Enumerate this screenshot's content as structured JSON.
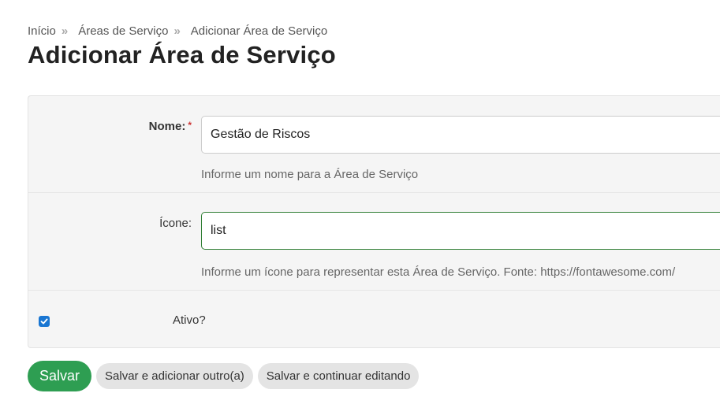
{
  "breadcrumb": {
    "items": [
      "Início",
      "Áreas de Serviço",
      "Adicionar Área de Serviço"
    ],
    "separator": "»"
  },
  "page_title": "Adicionar Área de Serviço",
  "form": {
    "name": {
      "label": "Nome:",
      "required_mark": "*",
      "value": "Gestão de Riscos",
      "help": "Informe um nome para a Área de Serviço"
    },
    "icon": {
      "label": "Ícone:",
      "value": "list",
      "help": "Informe um ícone para representar esta Área de Serviço. Fonte: https://fontawesome.com/"
    },
    "active": {
      "label": "Ativo?",
      "checked": true,
      "check_icon": "check-icon"
    }
  },
  "actions": {
    "save_label": "Salvar",
    "save_add_label": "Salvar e adicionar outro(a)",
    "save_continue_label": "Salvar e continuar editando"
  },
  "colors": {
    "save_button": "#2e9e52",
    "checkbox": "#1976d2",
    "required": "#cc3333",
    "focused_border": "#2e7d32"
  }
}
